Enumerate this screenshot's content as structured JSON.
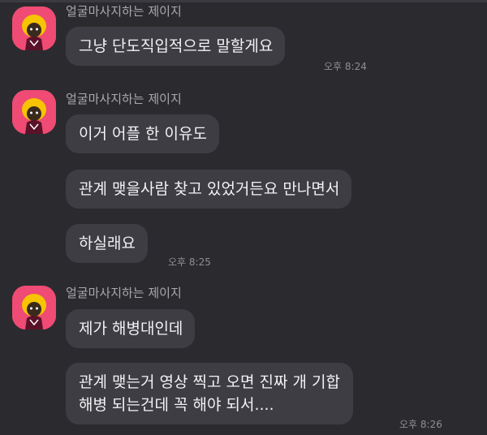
{
  "groups": [
    {
      "sender": "얼굴마사지하는 제이지",
      "messages": [
        {
          "text": "그냥 단도직입적으로 말할게요"
        }
      ],
      "time": "오후 8:24"
    },
    {
      "sender": "얼굴마사지하는 제이지",
      "messages": [
        {
          "text": "이거 어플 한 이유도"
        },
        {
          "text": "관계 맺을사람 찾고 있었거든요 만나면서"
        },
        {
          "text": "하실래요"
        }
      ],
      "time": "오후 8:25"
    },
    {
      "sender": "얼굴마사지하는 제이지",
      "messages": [
        {
          "text": "제가 해병대인데"
        },
        {
          "lines": [
            "관계 맺는거 영상 찍고 오면 진짜 개 기합",
            "해병 되는건데 꼭 해야 되서...."
          ]
        }
      ],
      "time": "오후 8:26"
    }
  ],
  "colors": {
    "background": "#2b2b2f",
    "bubble": "#3d3d43",
    "avatar_bg": "#ef4b74",
    "avatar_hair": "#f6c400"
  }
}
